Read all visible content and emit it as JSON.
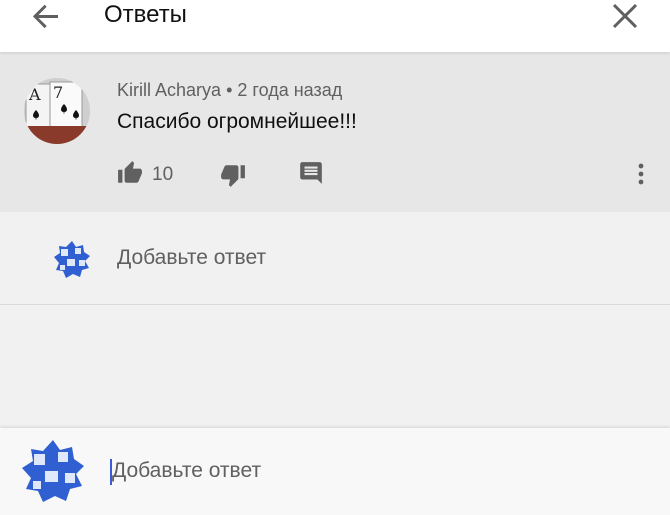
{
  "header": {
    "title": "Ответы",
    "back_icon": "arrow-left-icon",
    "close_icon": "close-icon"
  },
  "comment": {
    "author": "Kirill Acharya",
    "separator": "•",
    "time": "2 года назад",
    "text": "Спасибо огромнейшее!!!",
    "likes": "10",
    "icons": {
      "like": "thumb-up-icon",
      "dislike": "thumb-down-icon",
      "reply": "reply-comment-icon",
      "more": "more-vert-icon"
    }
  },
  "reply_row": {
    "placeholder": "Добавьте ответ"
  },
  "composer": {
    "placeholder": "Добавьте ответ"
  },
  "colors": {
    "header_bg": "#ffffff",
    "comment_bg": "#e7e7e7",
    "page_bg": "#f1f1f1",
    "secondary_text": "#606060",
    "avatar_blue": "#2f5fd0"
  }
}
